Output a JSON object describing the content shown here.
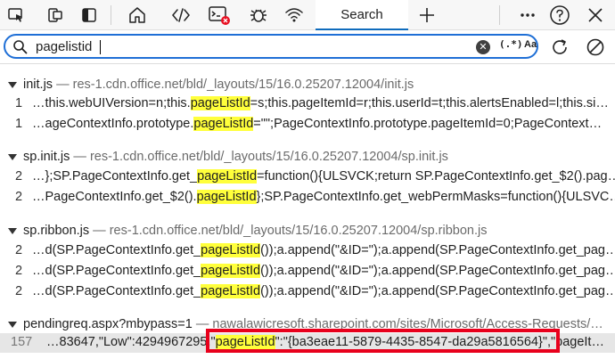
{
  "toolbar": {
    "tabs": [
      {
        "name": "inspect-icon"
      },
      {
        "name": "device-emulation-icon"
      },
      {
        "name": "toggle-drawer-icon"
      },
      {
        "name": "welcome-home-icon"
      },
      {
        "name": "elements-code-icon"
      },
      {
        "name": "console-icon"
      },
      {
        "name": "sources-bug-icon"
      },
      {
        "name": "network-wifi-icon"
      }
    ],
    "active_tab_label": "Search",
    "add_tab_icon": "plus-icon",
    "more_icon": "ellipsis-icon",
    "help_icon": "question-icon",
    "close_icon": "close-icon",
    "console_error_color": "#e81123"
  },
  "search": {
    "value": "pagelistid",
    "regex_label": "(.*)",
    "case_label": "Aa",
    "accent": "#1f6fd6"
  },
  "results": [
    {
      "file": "init.js",
      "sep": " — ",
      "url": "res-1.cdn.office.net/bld/_layouts/15/16.0.25207.12004/init.js",
      "matches": [
        {
          "line": "1",
          "pre": "…this.webUIVersion=n;this.",
          "hit": "pageListId",
          "post": "=s;this.pageItemId=r;this.userId=t;this.alertsEnabled=l;this.si…"
        },
        {
          "line": "1",
          "pre": "…ageContextInfo.prototype.",
          "hit": "pageListId",
          "post": "=\"\";PageContextInfo.prototype.pageItemId=0;PageContext…"
        }
      ]
    },
    {
      "file": "sp.init.js",
      "sep": " — ",
      "url": "res-1.cdn.office.net/bld/_layouts/15/16.0.25207.12004/sp.init.js",
      "matches": [
        {
          "line": "2",
          "pre": "…};SP.PageContextInfo.get_",
          "hit": "pageListId",
          "post": "=function(){ULSVCK;return SP.PageContextInfo.get_$2().pag…"
        },
        {
          "line": "2",
          "pre": "…PageContextInfo.get_$2().",
          "hit": "pageListId",
          "post": "};SP.PageContextInfo.get_webPermMasks=function(){ULSVC…"
        }
      ]
    },
    {
      "file": "sp.ribbon.js",
      "sep": " — ",
      "url": "res-1.cdn.office.net/bld/_layouts/15/16.0.25207.12004/sp.ribbon.js",
      "matches": [
        {
          "line": "2",
          "pre": "…d(SP.PageContextInfo.get_",
          "hit": "pageListId",
          "post": "());a.append(\"&ID=\");a.append(SP.PageContextInfo.get_pag…"
        },
        {
          "line": "2",
          "pre": "…d(SP.PageContextInfo.get_",
          "hit": "pageListId",
          "post": "());a.append(\"&ID=\");a.append(SP.PageContextInfo.get_pag…"
        },
        {
          "line": "2",
          "pre": "…d(SP.PageContextInfo.get_",
          "hit": "pageListId",
          "post": "());a.append(\"&ID=\");a.append(SP.PageContextInfo.get_pag…"
        }
      ]
    },
    {
      "file": "pendingreq.aspx?mbypass=1",
      "sep": " — ",
      "url": "nawalawicresoft.sharepoint.com/sites/Microsoft/Access-Requests/…",
      "matches": [
        {
          "line": "157",
          "pre": "…83647,\"Low\":4294967295,\"",
          "hit": "pageListId",
          "post": "\":\"{ba3eae11-5879-4435-8547-da29a5816564}\",\"pageIt…"
        }
      ]
    }
  ],
  "highlight_color": "#ffff3b",
  "focus_box_color": "#e8001c"
}
